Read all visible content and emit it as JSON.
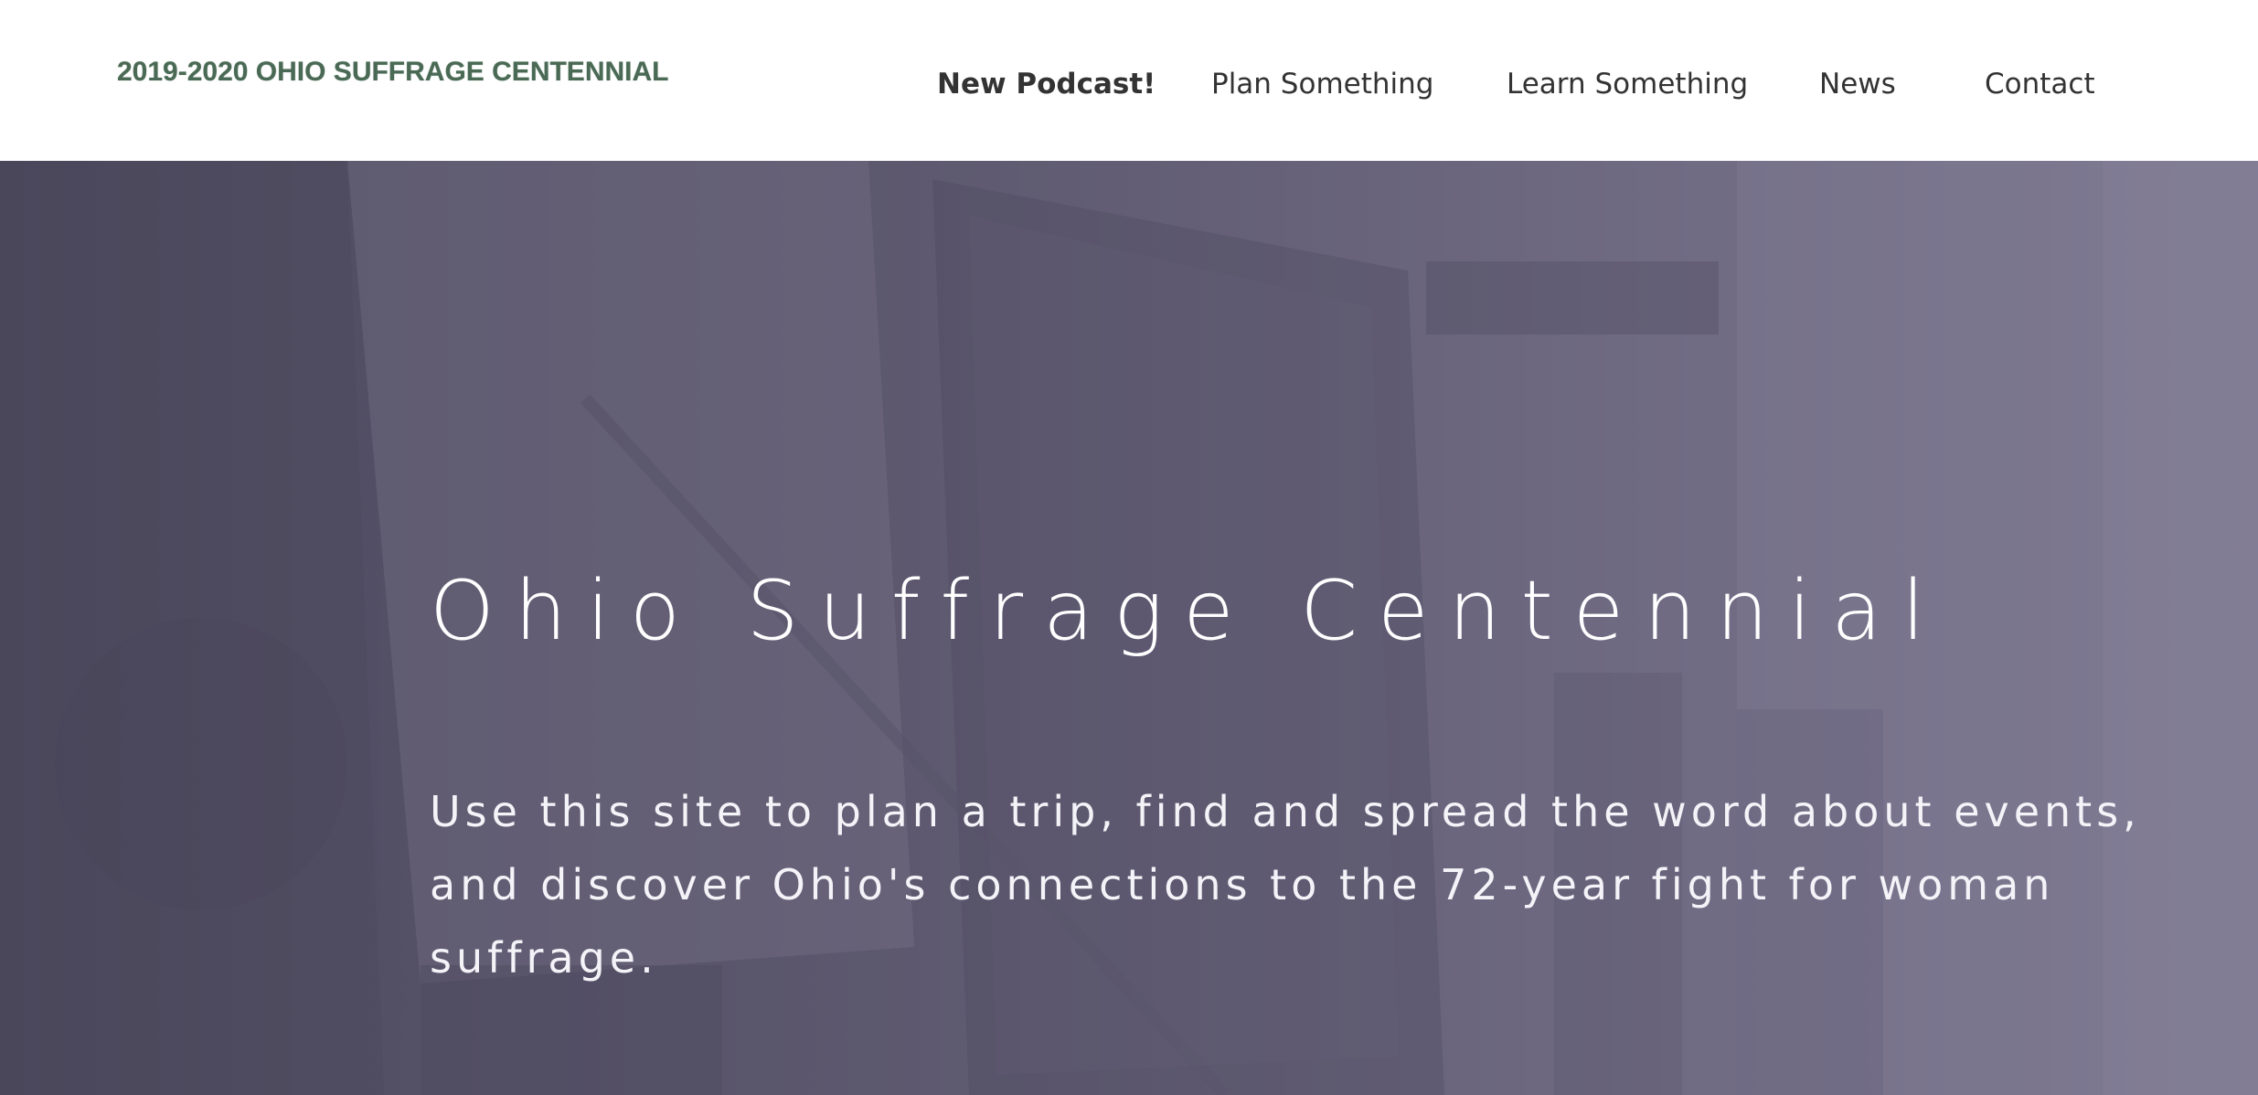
{
  "header": {
    "logo_text": "2019-2020 OHIO SUFFRAGE CENTENNIAL",
    "nav": {
      "podcast": "New Podcast!",
      "plan": "Plan Something",
      "learn": "Learn Something",
      "news": "News",
      "contact": "Contact"
    }
  },
  "hero": {
    "title": "Ohio Suffrage Centennial",
    "text": "Use this site to plan a trip, find and spread the word about events, and discover Ohio's connections to the 72-year fight for woman suffrage."
  },
  "colors": {
    "logo": "#4a6a55",
    "nav_text": "#333333",
    "hero_overlay": "#5e5a70",
    "hero_text": "#ffffff"
  }
}
